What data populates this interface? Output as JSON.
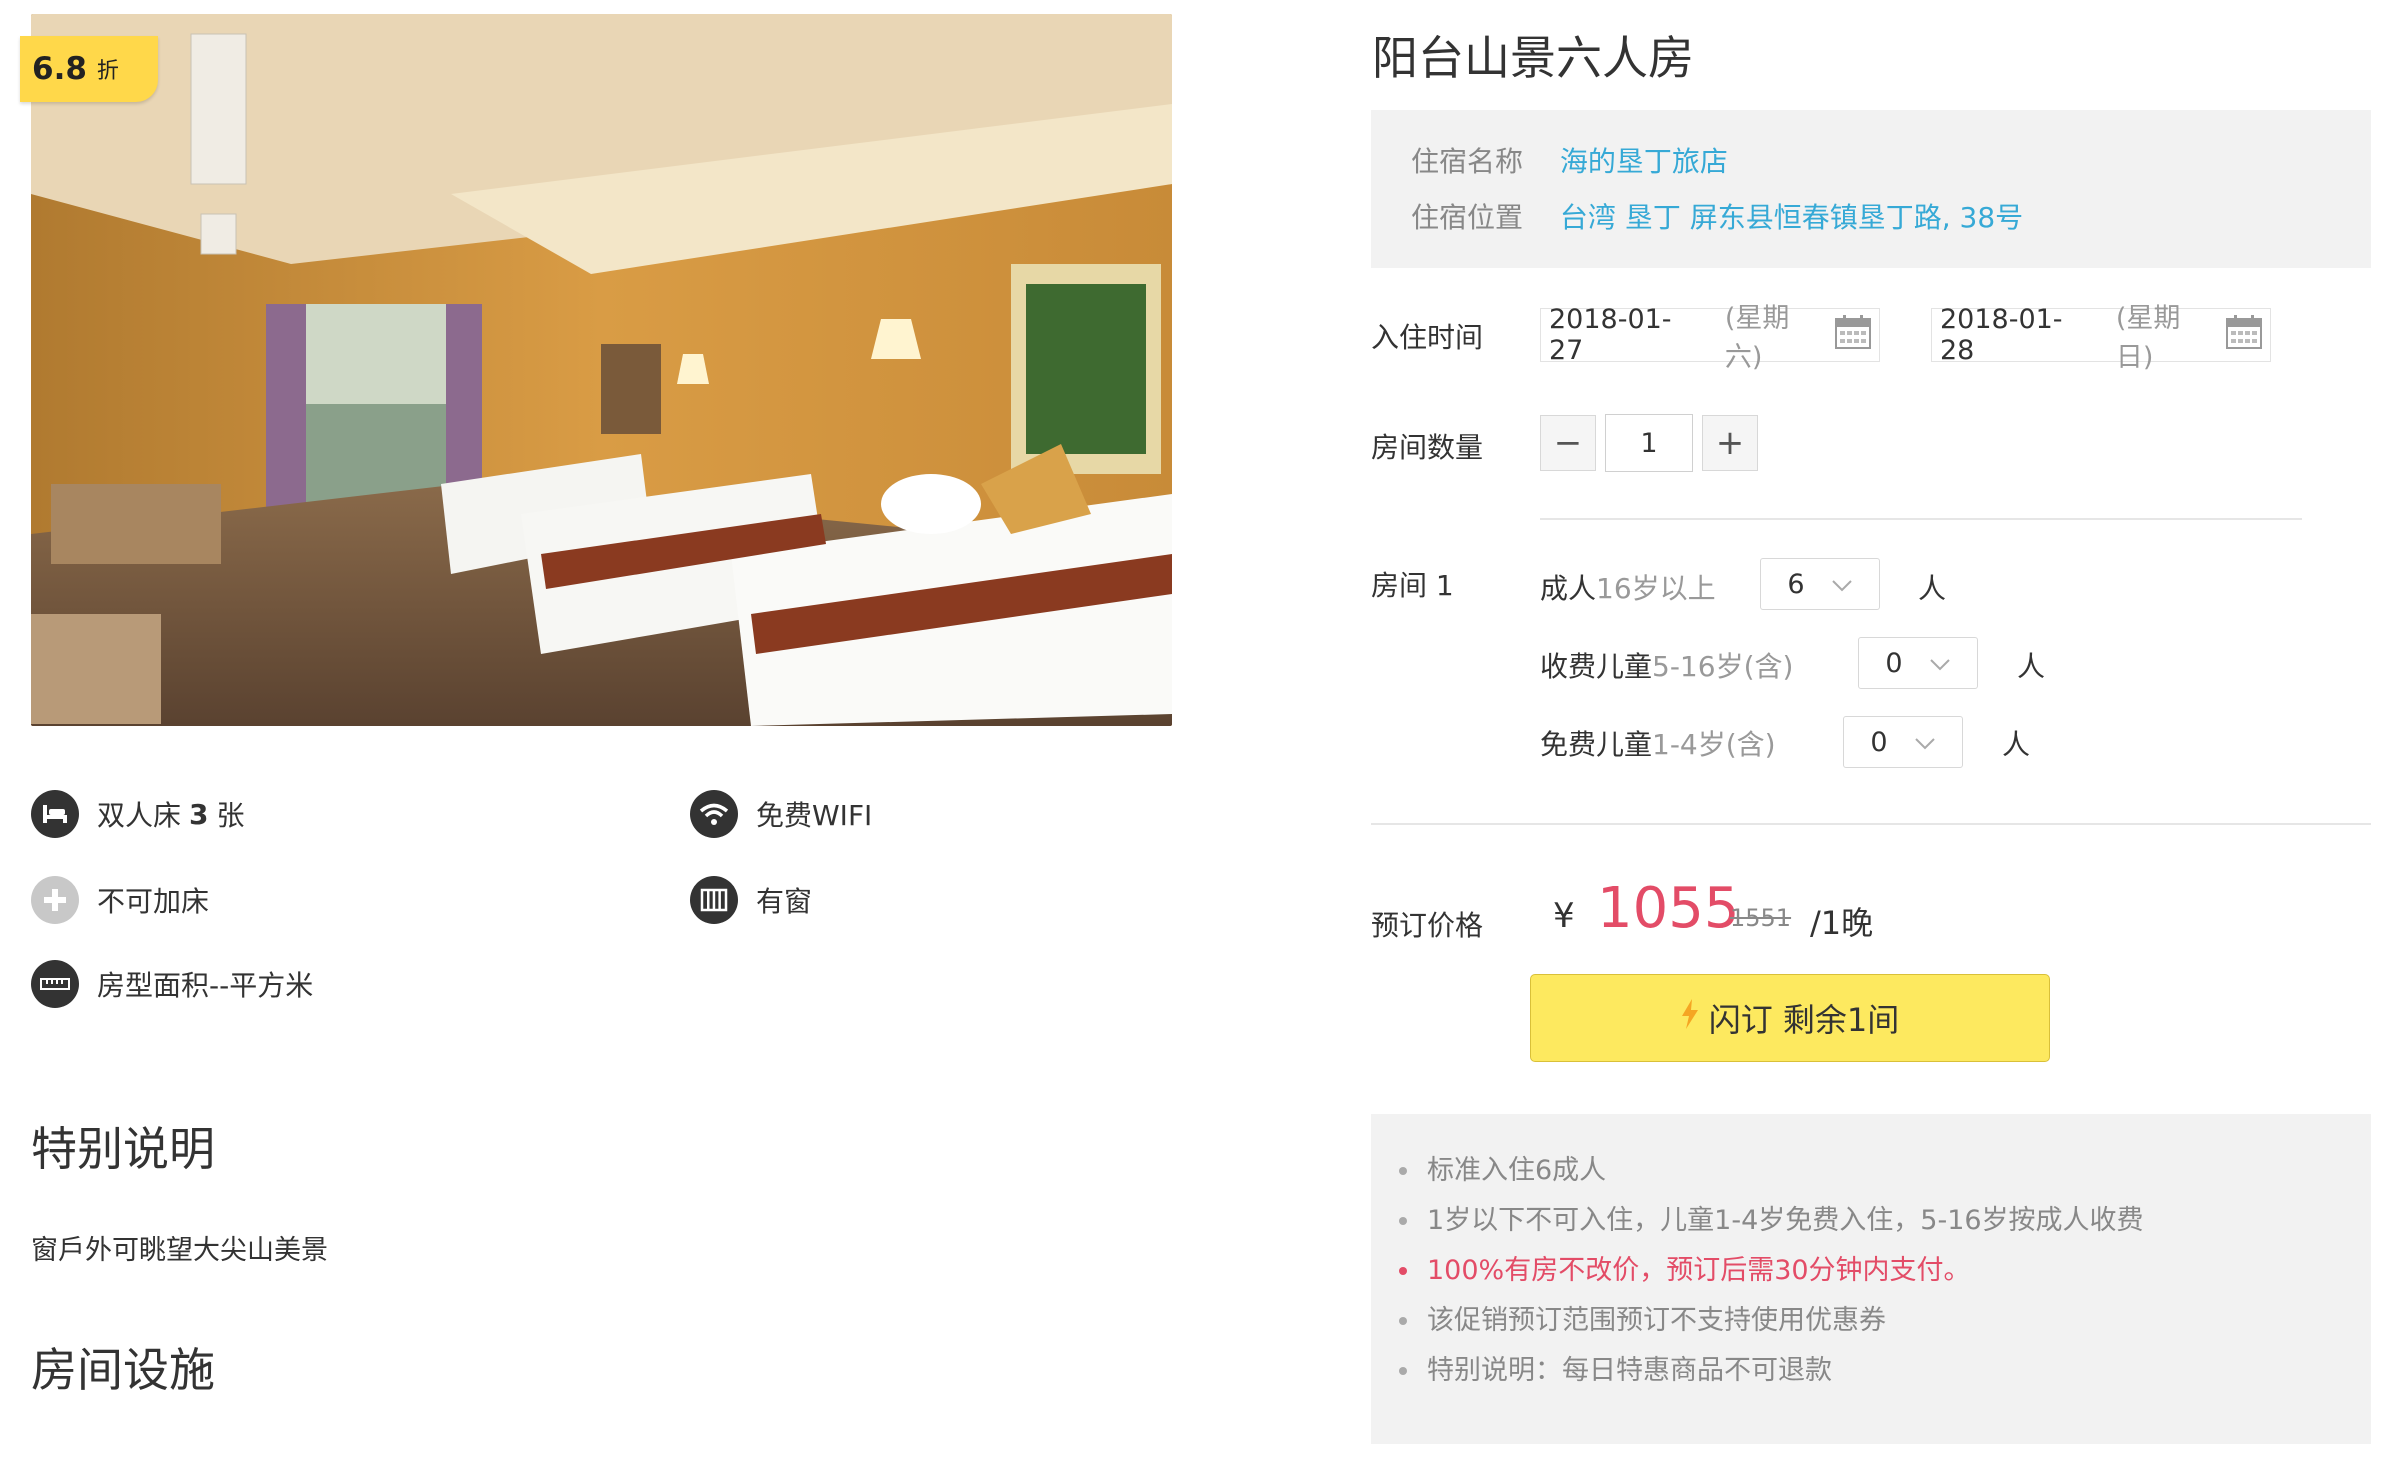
{
  "badge": {
    "value": "6.8",
    "unit": "折"
  },
  "features": [
    {
      "icon": "bed-icon",
      "label": "双人床",
      "count": "3",
      "suffix": "张"
    },
    {
      "icon": "wifi-icon",
      "label": "免费WIFI"
    },
    {
      "icon": "plus-icon",
      "label": "不可加床"
    },
    {
      "icon": "window-icon",
      "label": "有窗"
    },
    {
      "icon": "ruler-icon",
      "label": "房型面积--平方米"
    }
  ],
  "special": {
    "title": "特别说明",
    "text": "窗戶外可眺望大尖山美景"
  },
  "facilities": {
    "title": "房间设施"
  },
  "room": {
    "title": "阳台山景六人房",
    "hotel_label": "住宿名称",
    "hotel_name": "海的垦丁旅店",
    "location_label": "住宿位置",
    "location": "台湾 垦丁 屏东县恒春镇垦丁路, 38号"
  },
  "booking": {
    "checkin_label": "入住时间",
    "checkin_date": "2018-01-27",
    "checkin_weekday": "(星期六)",
    "checkout_date": "2018-01-28",
    "checkout_weekday": "(星期日)",
    "rooms_label": "房间数量",
    "rooms_value": "1",
    "minus": "−",
    "plus": "+",
    "room_no_label": "房间 1",
    "guests": [
      {
        "label": "成人",
        "sub": "16岁以上",
        "value": "6",
        "unit": "人"
      },
      {
        "label": "收费儿童",
        "sub": "5-16岁(含)",
        "value": "0",
        "unit": "人"
      },
      {
        "label": "免费儿童",
        "sub": "1-4岁(含)",
        "value": "0",
        "unit": "人"
      }
    ],
    "price_label": "预订价格",
    "currency": "¥",
    "price": "1055",
    "original_price": "1551",
    "per_night": "/1晚",
    "button_label": "闪订 剩余1间"
  },
  "notes": [
    {
      "text": "标准入住6成人",
      "alert": false
    },
    {
      "text": "1岁以下不可入住，儿童1-4岁免费入住，5-16岁按成人收费",
      "alert": false
    },
    {
      "text": "100%有房不改价，预订后需30分钟内支付。",
      "alert": true
    },
    {
      "text": "该促销预订范围预订不支持使用优惠券",
      "alert": false
    },
    {
      "text": "特别说明：每日特惠商品不可退款",
      "alert": false
    }
  ],
  "colors": {
    "accent_yellow": "#fde95f",
    "price_red": "#e34c67",
    "link_blue": "#36a9d6"
  }
}
